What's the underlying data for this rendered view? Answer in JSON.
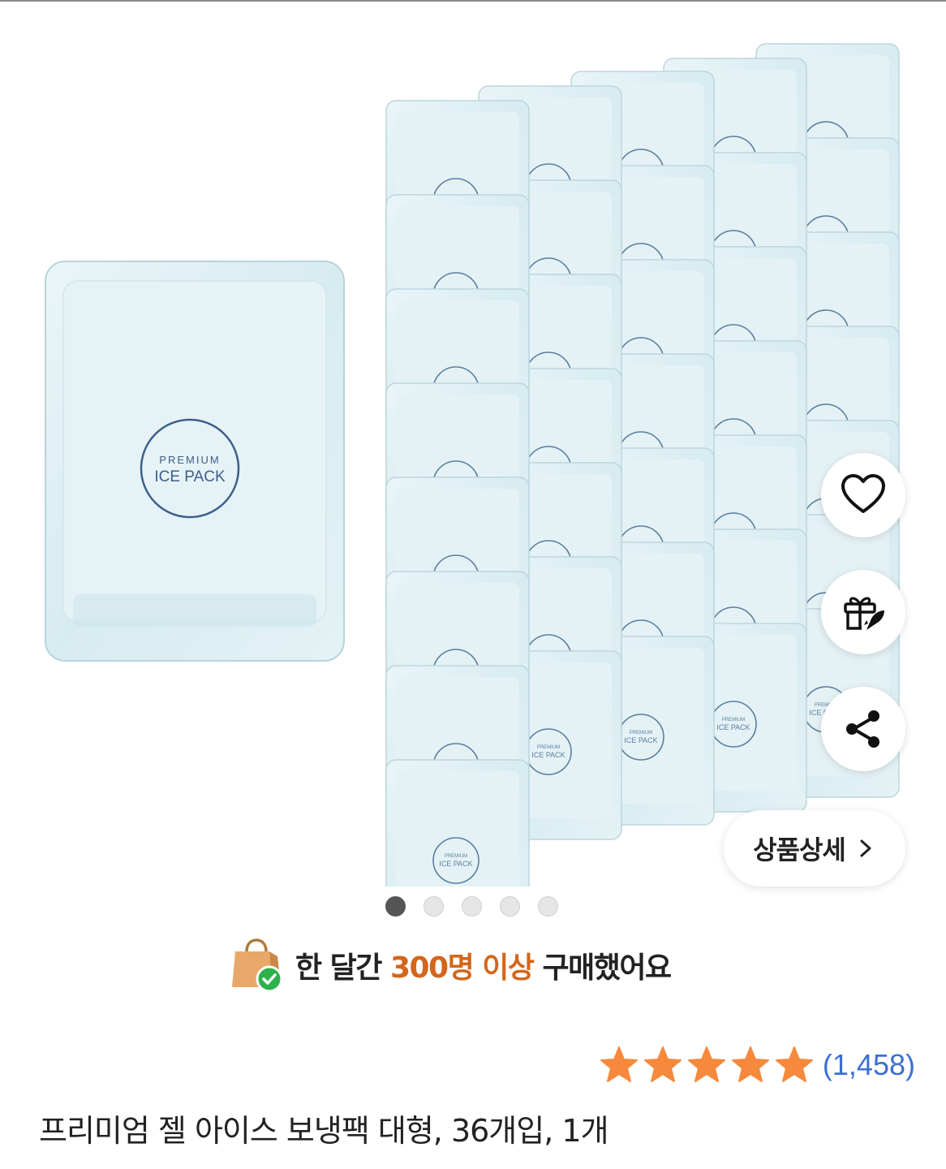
{
  "product_image": {
    "pack_brand_line1": "PREMIUM",
    "pack_brand_line2": "ICE PACK",
    "pack_count_shown": 36
  },
  "actions": {
    "like_icon": "heart-icon",
    "gift_icon": "gift-rocket-icon",
    "share_icon": "share-icon",
    "detail_label": "상품상세",
    "detail_icon": "chevron-right-icon"
  },
  "carousel": {
    "total": 5,
    "active_index": 0
  },
  "purchase_info": {
    "icon": "shopping-bag-check-icon",
    "prefix": "한 달간 ",
    "highlight": "300명 이상",
    "suffix": " 구매했어요",
    "highlight_color": "#d4661b"
  },
  "rating": {
    "stars": 5,
    "star_color": "#f6893c",
    "review_count": "(1,458)",
    "count_color": "#3d6fd1"
  },
  "product_title": "프리미엄 젤 아이스 보냉팩 대형, 36개입, 1개"
}
